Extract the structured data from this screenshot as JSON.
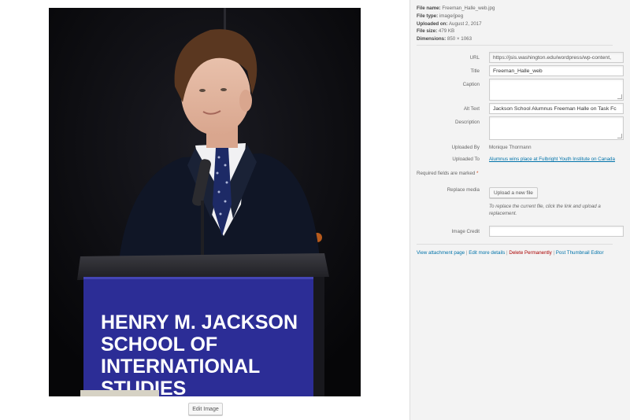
{
  "media": {
    "podium_lines": [
      "HENRY M. JACKSON",
      "SCHOOL OF",
      "INTERNATIONAL",
      "STUDIES"
    ],
    "edit_image_label": "Edit Image"
  },
  "file_info": {
    "name_label": "File name:",
    "name_value": "Freeman_Halle_web.jpg",
    "type_label": "File type:",
    "type_value": "image/jpeg",
    "uploaded_label": "Uploaded on:",
    "uploaded_value": "August 2, 2017",
    "size_label": "File size:",
    "size_value": "479 KB",
    "dimensions_label": "Dimensions:",
    "dimensions_value": "850 × 1063"
  },
  "fields": {
    "url_label": "URL",
    "url_value": "https://jsis.washington.edu/wordpress/wp-content,",
    "title_label": "Title",
    "title_value": "Freeman_Halle_web",
    "caption_label": "Caption",
    "caption_value": "",
    "alt_label": "Alt Text",
    "alt_value": "Jackson School Alumnus Freeman Halle on Task Fc",
    "description_label": "Description",
    "description_value": "",
    "uploaded_by_label": "Uploaded By",
    "uploaded_by_value": "Monique Thormann",
    "uploaded_to_label": "Uploaded To",
    "uploaded_to_value": "Alumnus wins place at Fulbright Youth Institute on Canada",
    "required_note": "Required fields are marked",
    "required_star": "*",
    "replace_label": "Replace media",
    "upload_button": "Upload a new file",
    "replace_help": "To replace the current file, click the link and upload a replacement.",
    "credit_label": "Image Credit",
    "credit_value": ""
  },
  "actions": {
    "view": "View attachment page",
    "edit_more": "Edit more details",
    "delete": "Delete Permanently",
    "thumbnail": "Post Thumbnail Editor",
    "separator": "|"
  }
}
